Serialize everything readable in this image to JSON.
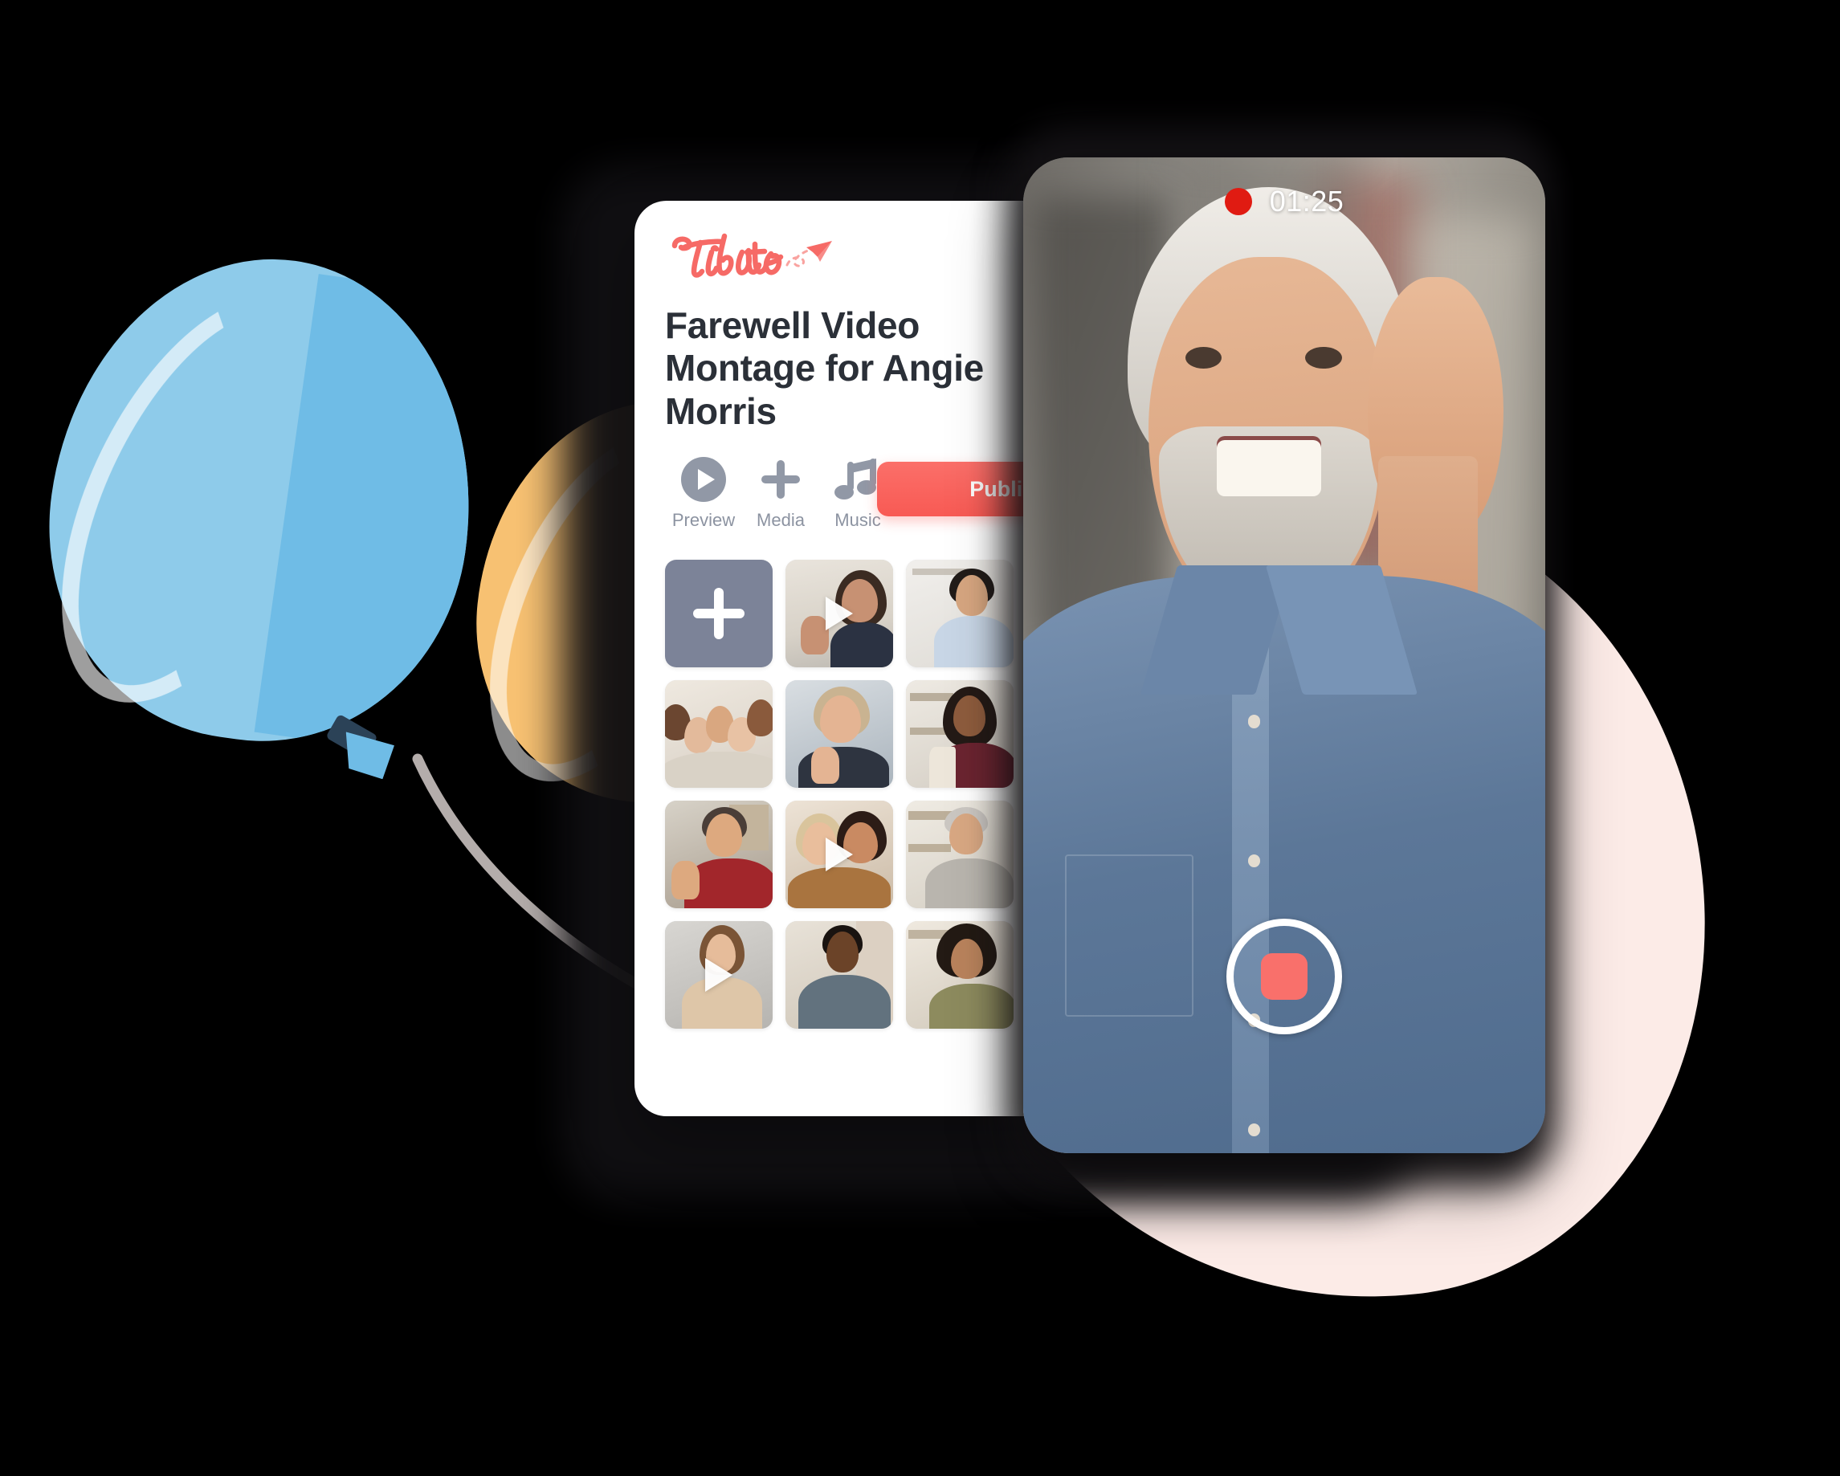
{
  "scene": {
    "background_color": "#000000",
    "pink_blob_color": "#FCEBE7"
  },
  "balloons": [
    {
      "name": "blue-balloon",
      "color": "#8ECBEA",
      "shade_color": "#6FBCE6",
      "knot_color": "#2B4257"
    },
    {
      "name": "yellow-balloon",
      "color": "#F7C172",
      "shade_color": "#EFA93F",
      "knot_color": "#2B4257"
    }
  ],
  "app_card": {
    "logo_text": "Tribute",
    "logo_color": "#F66A66",
    "menu_icon": "hamburger-menu-icon",
    "title": "Farewell Video Montage for Angie Morris",
    "toolbar": {
      "items": [
        {
          "label": "Preview",
          "icon": "play-circle-icon"
        },
        {
          "label": "Media",
          "icon": "plus-icon"
        },
        {
          "label": "Music",
          "icon": "music-note-icon"
        }
      ],
      "publish_label": "Publish",
      "publish_color": "#F85A54"
    },
    "grid": {
      "add_tile": {
        "label": "",
        "icon": "plus-icon",
        "color": "#7C8398"
      },
      "tiles": [
        {
          "name": "add-media-tile",
          "type": "add"
        },
        {
          "name": "thumb-woman-waving-office",
          "type": "video",
          "has_play": true
        },
        {
          "name": "thumb-man-blue-shirt-shelf",
          "type": "photo",
          "has_play": false
        },
        {
          "name": "thumb-group-friends-selfie",
          "type": "photo",
          "has_play": false
        },
        {
          "name": "thumb-senior-woman-glasses-waving",
          "type": "photo",
          "has_play": false
        },
        {
          "name": "thumb-woman-bookshelf",
          "type": "photo",
          "has_play": false
        },
        {
          "name": "thumb-man-plaid-shirt-waving",
          "type": "photo",
          "has_play": false
        },
        {
          "name": "thumb-two-women-hugging",
          "type": "video",
          "has_play": true
        },
        {
          "name": "thumb-senior-man-library",
          "type": "photo",
          "has_play": false
        },
        {
          "name": "thumb-woman-beige-sweater",
          "type": "video",
          "has_play": true
        },
        {
          "name": "thumb-man-grey-shirt-brick",
          "type": "photo",
          "has_play": false
        },
        {
          "name": "thumb-woman-curly-hair-olive",
          "type": "photo",
          "has_play": false
        }
      ]
    }
  },
  "phone": {
    "recording": {
      "indicator": "record-dot-icon",
      "indicator_color": "#E01B12",
      "timer": "01:25"
    },
    "stop_button": {
      "name": "stop-recording-button",
      "shape": "rounded-square",
      "color": "#F9706B"
    },
    "video_subject": "smiling senior man with white beard in denim shirt waving at camera"
  }
}
